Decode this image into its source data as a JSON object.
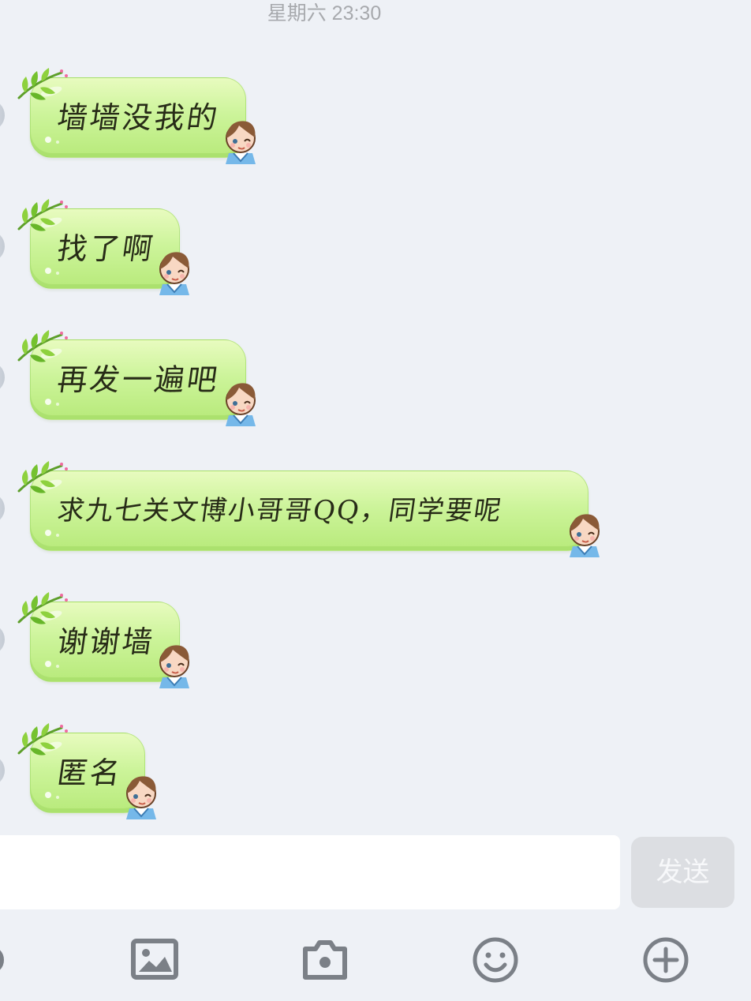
{
  "header": {
    "timestamp": "星期六 23:30"
  },
  "messages": [
    {
      "text": "墙墙没我的"
    },
    {
      "text": "找了啊"
    },
    {
      "text": "再发一遍吧"
    },
    {
      "text": "求九七关文博小哥哥QQ，同学要呢"
    },
    {
      "text": "谢谢墙"
    },
    {
      "text": "匿名"
    }
  ],
  "composer": {
    "input_value": "",
    "send_label": "发送"
  },
  "toolbar": {
    "icons": [
      "voice-icon",
      "image-icon",
      "camera-icon",
      "emoji-icon",
      "plus-icon"
    ]
  },
  "colors": {
    "background": "#eef1f6",
    "bubble_green": "#ccf49a",
    "send_disabled": "#dcdee2",
    "toolbar_icon": "#7b8087"
  }
}
